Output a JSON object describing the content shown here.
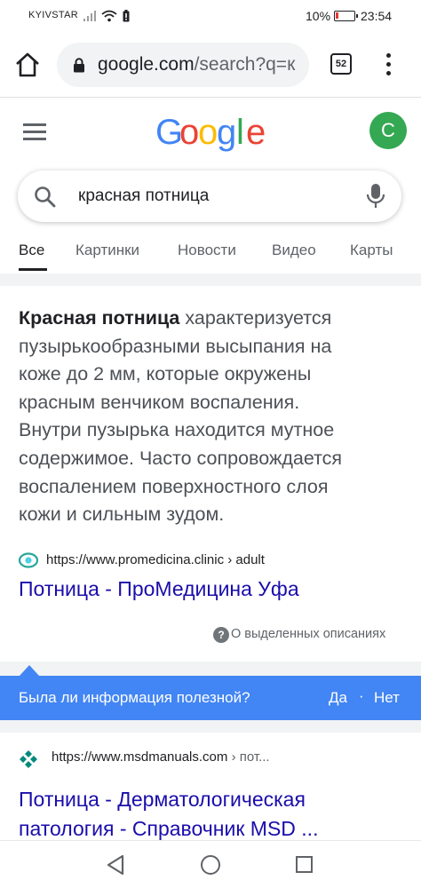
{
  "status_bar": {
    "carrier": "KYIVSTAR",
    "battery_percent": "10%",
    "time": "23:54"
  },
  "browser": {
    "url_host": "google.com",
    "url_rest": "/search?q=к",
    "tab_count": "52"
  },
  "header": {
    "logo_letters": [
      "G",
      "o",
      "o",
      "g",
      "l",
      "e"
    ],
    "logo_colors": [
      "#4285f4",
      "#ea4335",
      "#fbbc05",
      "#4285f4",
      "#34a853",
      "#ea4335"
    ],
    "avatar_letter": "C"
  },
  "search": {
    "query": "красная потница"
  },
  "tabs": [
    {
      "label": "Все",
      "active": true
    },
    {
      "label": "Картинки",
      "active": false
    },
    {
      "label": "Новости",
      "active": false
    },
    {
      "label": "Видео",
      "active": false
    },
    {
      "label": "Карты",
      "active": false
    }
  ],
  "featured_snippet": {
    "lines": [
      {
        "bold": "Красная потница",
        "text": " характеризуется"
      },
      {
        "bold": "",
        "text": "пузырькообразными высыпания на"
      },
      {
        "bold": "",
        "text": "коже до 2 мм, которые окружены"
      },
      {
        "bold": "",
        "text": "красным венчиком воспаления."
      },
      {
        "bold": "",
        "text": "Внутри пузырька находится мутное"
      },
      {
        "bold": "",
        "text": "содержимое. Часто сопровождается"
      },
      {
        "bold": "",
        "text": "воспалением поверхностного слоя"
      },
      {
        "bold": "",
        "text": "кожи и сильным зудом."
      }
    ],
    "source_url": "https://www.promedicina.clinic › adult",
    "title": "Потница - ПроМедицина Уфа",
    "about_label": "О выделенных описаниях"
  },
  "feedback": {
    "question": "Была ли информация полезной?",
    "yes": "Да",
    "separator": "·",
    "no": "Нет"
  },
  "result2": {
    "source_url": "https://www.msdmanuals.com",
    "source_tail": " › пот...",
    "title_line1": "Потница - Дерматологическая",
    "title_line2": "патология - Справочник MSD ..."
  },
  "colors": {
    "link": "#1a0dab",
    "feedback_bar": "#4285f4",
    "avatar": "#34a853",
    "battery_low": "#e53935"
  }
}
